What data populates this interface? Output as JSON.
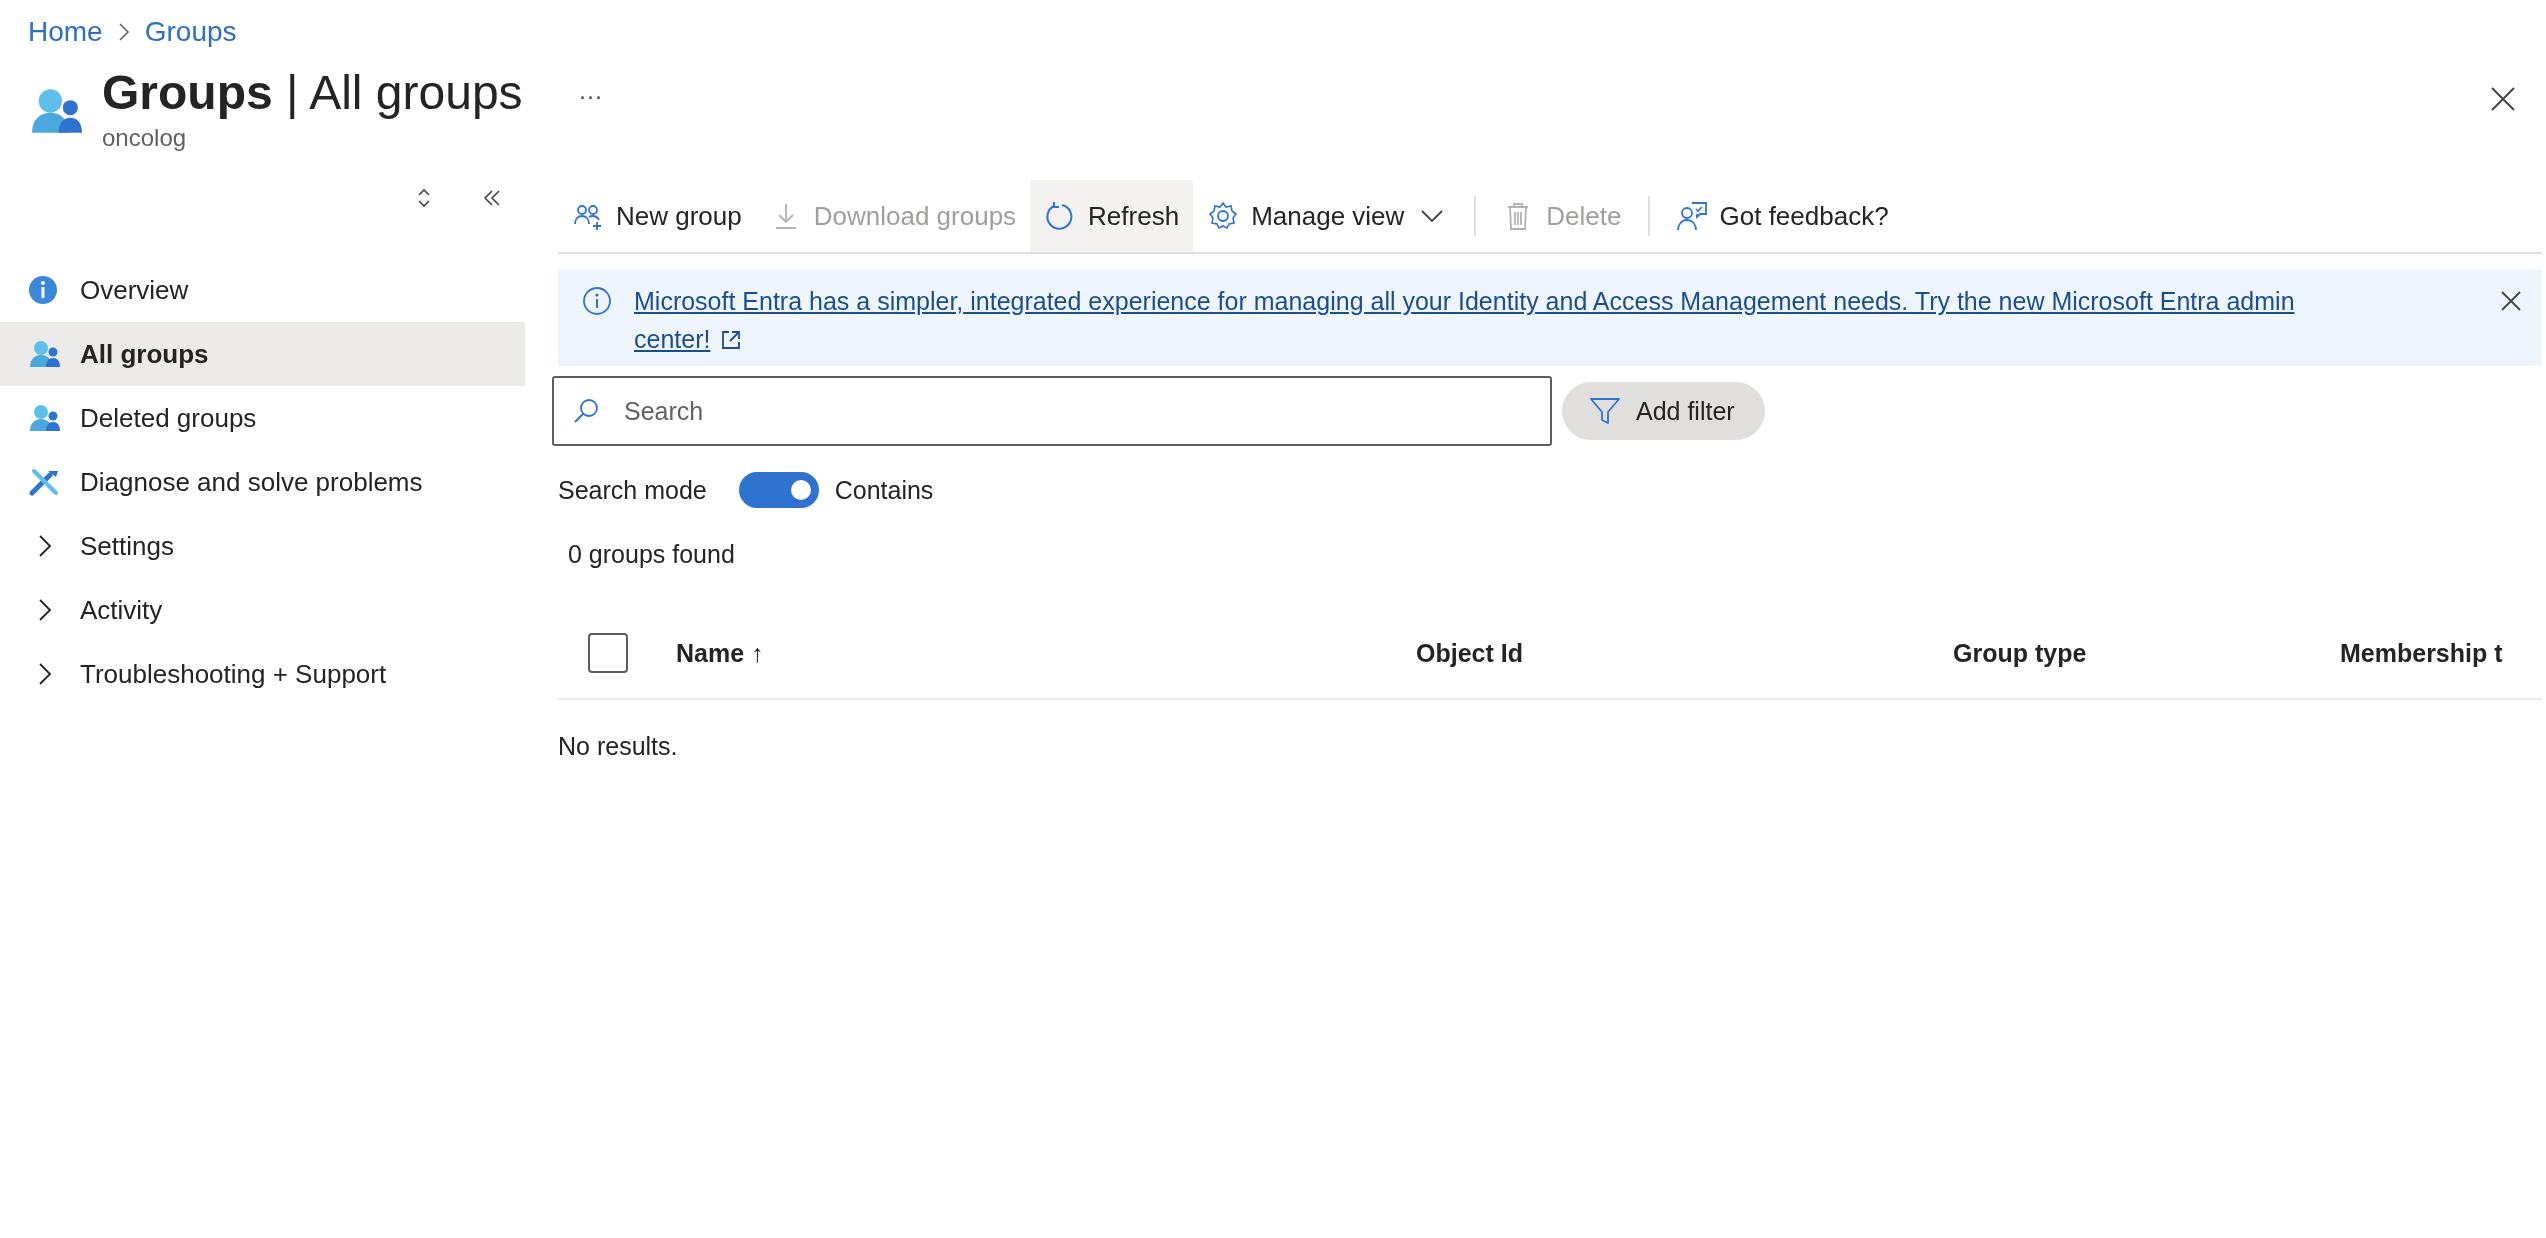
{
  "breadcrumb": [
    {
      "label": "Home"
    },
    {
      "label": "Groups"
    }
  ],
  "header": {
    "title_bold": "Groups",
    "title_rest": "| All groups",
    "subtitle": "oncolog",
    "more": "···"
  },
  "sidebar": {
    "items": [
      {
        "kind": "info",
        "label": "Overview",
        "selected": false
      },
      {
        "kind": "groups",
        "label": "All groups",
        "selected": true
      },
      {
        "kind": "groups",
        "label": "Deleted groups",
        "selected": false
      },
      {
        "kind": "tools",
        "label": "Diagnose and solve problems",
        "selected": false
      },
      {
        "kind": "expandable",
        "label": "Settings",
        "selected": false,
        "expanded": false
      },
      {
        "kind": "expandable",
        "label": "Activity",
        "selected": false,
        "expanded": false
      },
      {
        "kind": "expandable",
        "label": "Troubleshooting + Support",
        "selected": false,
        "expanded": false
      }
    ]
  },
  "toolbar": [
    {
      "kind": "add-people",
      "label": "New group",
      "disabled": false,
      "highlighted": false,
      "separator_before": false
    },
    {
      "kind": "download",
      "label": "Download groups",
      "disabled": true,
      "highlighted": false,
      "separator_before": false
    },
    {
      "kind": "refresh",
      "label": "Refresh",
      "disabled": false,
      "highlighted": true,
      "separator_before": false
    },
    {
      "kind": "gear-dropdown",
      "label": "Manage view",
      "disabled": false,
      "highlighted": false,
      "separator_before": false
    },
    {
      "kind": "trash",
      "label": "Delete",
      "disabled": true,
      "highlighted": false,
      "separator_before": true
    },
    {
      "kind": "feedback",
      "label": "Got feedback?",
      "disabled": false,
      "highlighted": false,
      "separator_before": true
    }
  ],
  "banner": {
    "text": "Microsoft Entra has a simpler, integrated experience for managing all your Identity and Access Management needs. Try the new Microsoft Entra admin center!"
  },
  "search": {
    "placeholder": "Search"
  },
  "add_filter": "Add filter",
  "search_mode": {
    "label": "Search mode",
    "on": true,
    "value_label": "Contains"
  },
  "result_count": "0 groups found",
  "table": {
    "select_all_checked": false,
    "columns": [
      {
        "label": "Name",
        "sort_indicator": "↑"
      },
      {
        "label": "Object Id"
      },
      {
        "label": "Group type"
      },
      {
        "label": "Membership t"
      }
    ],
    "empty_message": "No results."
  }
}
